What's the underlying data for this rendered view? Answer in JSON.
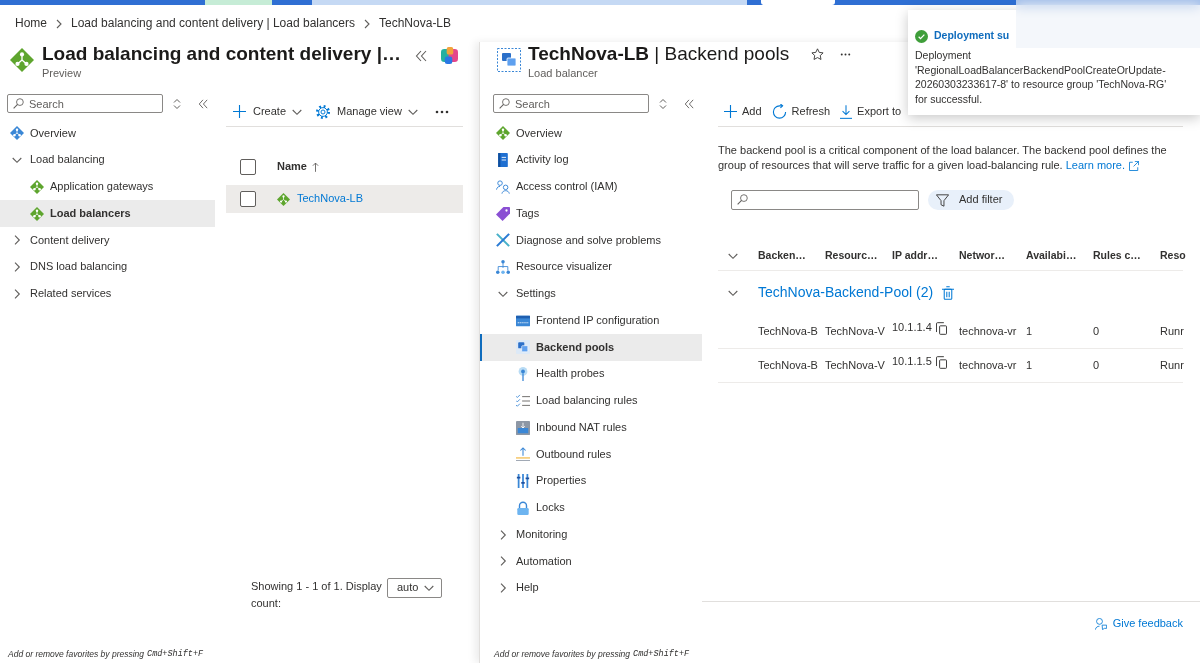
{
  "breadcrumb": [
    "Home",
    "Load balancing and content delivery | Load balancers",
    "TechNova-LB"
  ],
  "left_blade": {
    "title": "Load balancing and content delivery |…",
    "subtitle": "Preview",
    "menu": {
      "search": {
        "placeholder": "Search"
      },
      "items": [
        {
          "label": "Overview",
          "selected": false
        },
        {
          "label": "Load balancing",
          "selected": false,
          "expanded": true,
          "children": [
            {
              "label": "Application gateways",
              "selected": false
            },
            {
              "label": "Load balancers",
              "selected": true
            }
          ]
        },
        {
          "label": "Content delivery",
          "selected": false,
          "expanded": false
        },
        {
          "label": "DNS load balancing",
          "selected": false,
          "expanded": false
        },
        {
          "label": "Related services",
          "selected": false,
          "expanded": false
        }
      ]
    },
    "toolbar": [
      {
        "label": "Create",
        "dropdown": true
      },
      {
        "label": "Manage view",
        "dropdown": true
      }
    ],
    "table": {
      "header_checked": false,
      "columns": [
        {
          "label": "Name",
          "sort_ascending": true
        }
      ],
      "rows": [
        {
          "name": "TechNova-LB",
          "checked": false,
          "hovered": true
        }
      ]
    },
    "pager": {
      "text": "Showing 1 - 1 of 1. Display count:",
      "value": "auto"
    },
    "footer": {
      "text": "Add or remove favorites by pressing",
      "shortcut": "Cmd+Shift+F"
    }
  },
  "right_blade": {
    "title": "**TechNova-LB** | Backend pools",
    "subtitle": "Load balancer",
    "favorite": false,
    "menu": {
      "search": {
        "placeholder": "Search"
      },
      "items": [
        {
          "label": "Overview",
          "selected": false
        },
        {
          "label": "Activity log",
          "selected": false
        },
        {
          "label": "Access control (IAM)",
          "selected": false
        },
        {
          "label": "Tags",
          "selected": false
        },
        {
          "label": "Diagnose and solve problems",
          "selected": false
        },
        {
          "label": "Resource visualizer",
          "selected": false
        },
        {
          "label": "Settings",
          "selected": false,
          "expanded": true,
          "children": [
            {
              "label": "Frontend IP configuration",
              "selected": false
            },
            {
              "label": "Backend pools",
              "selected": true
            },
            {
              "label": "Health probes",
              "selected": false
            },
            {
              "label": "Load balancing rules",
              "selected": false
            },
            {
              "label": "Inbound NAT rules",
              "selected": false
            },
            {
              "label": "Outbound rules",
              "selected": false
            },
            {
              "label": "Properties",
              "selected": false
            },
            {
              "label": "Locks",
              "selected": false
            }
          ]
        },
        {
          "label": "Monitoring",
          "selected": false,
          "expanded": false
        },
        {
          "label": "Automation",
          "selected": false,
          "expanded": false
        },
        {
          "label": "Help",
          "selected": false,
          "expanded": false
        }
      ]
    },
    "toolbar": [
      {
        "label": "Add"
      },
      {
        "label": "Refresh"
      },
      {
        "label": "Export to"
      }
    ],
    "description": {
      "text": "The backend pool is a critical component of the load balancer. The backend pool defines the group of resources that will serve traffic for a given load-balancing rule.",
      "link": "Learn more."
    },
    "filter": {
      "button": "Add filter"
    },
    "table": {
      "columns": [
        {
          "label": "Backen…",
          "kind": "text"
        },
        {
          "label": "Resourc…",
          "kind": "text"
        },
        {
          "label": "IP addr…",
          "kind": "copyable"
        },
        {
          "label": "Networ…",
          "kind": "text"
        },
        {
          "label": "Availabi…",
          "kind": "text"
        },
        {
          "label": "Rules c…",
          "kind": "text"
        },
        {
          "label": "Reso",
          "kind": "text"
        }
      ],
      "groups": [
        {
          "name": "TechNova-Backend-Pool (2)",
          "expanded": true,
          "rows": [
            [
              "TechNova-B",
              "TechNova-V",
              "10.1.1.4",
              "technova-vr",
              "1",
              "0",
              "Runr"
            ],
            [
              "TechNova-B",
              "TechNova-V",
              "10.1.1.5",
              "technova-vr",
              "1",
              "0",
              "Runr"
            ]
          ]
        }
      ]
    },
    "feedback": "Give feedback",
    "footer": {
      "text": "Add or remove favorites by pressing",
      "shortcut": "Cmd+Shift+F"
    }
  },
  "notification": {
    "success": true,
    "title": "Deployment su",
    "message": "Deployment 'RegionalLoadBalancerBackendPoolCreateOrUpdate-20260303233617-8' to resource group 'TechNova-RG' for successful."
  }
}
